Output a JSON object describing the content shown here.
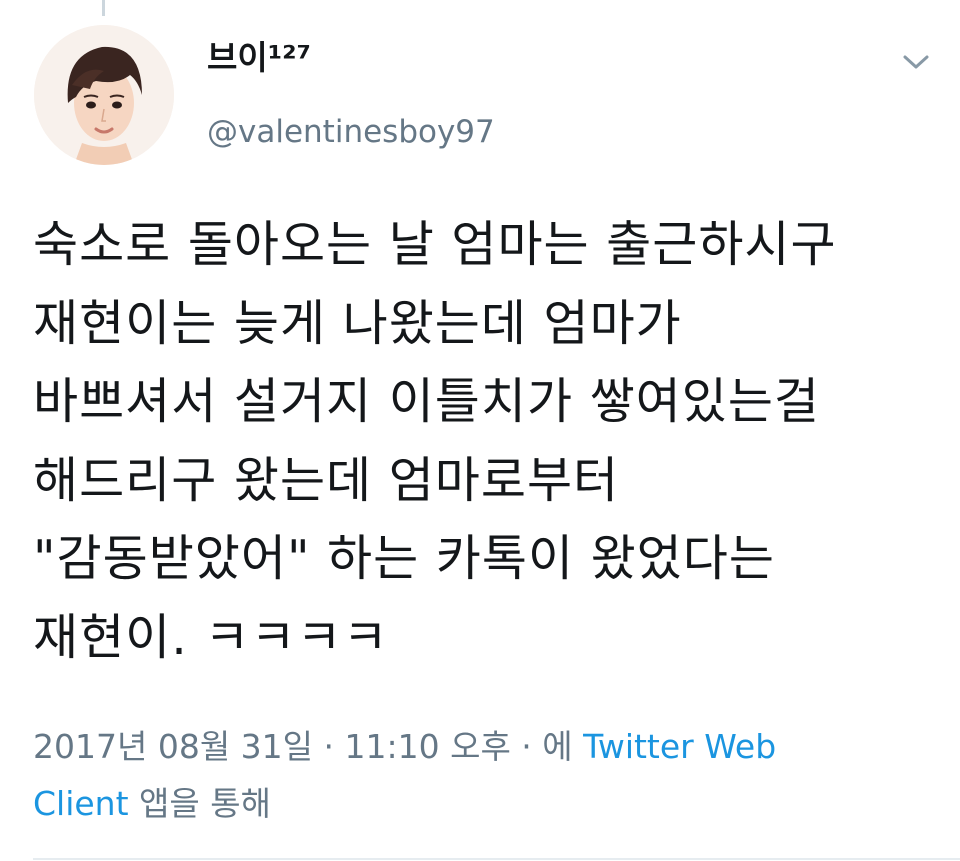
{
  "tweet": {
    "author": {
      "display_name": "브이¹²⁷",
      "handle": "@valentinesboy97",
      "avatar_icon": "avatar-illustration"
    },
    "menu_icon": "chevron-down-icon",
    "text_lines": [
      "숙소로 돌아오는 날 엄마는 출근하시구",
      "재현이는 늦게 나왔는데 엄마가",
      "바쁘셔서 설거지 이틀치가 쌓여있는걸",
      "해드리구 왔는데 엄마로부터",
      "\"감동받았어\" 하는 카톡이 왔었다는",
      "재현이. ㅋㅋㅋㅋ"
    ],
    "meta": {
      "timestamp": "2017년 08월 31일 · 11:10 오후 · 에",
      "source_link": "Twitter Web Client",
      "suffix": "앱을 통해"
    }
  },
  "colors": {
    "text": "#14171a",
    "secondary": "#657786",
    "link": "#1b95e0",
    "divider": "#e6ecf0"
  }
}
